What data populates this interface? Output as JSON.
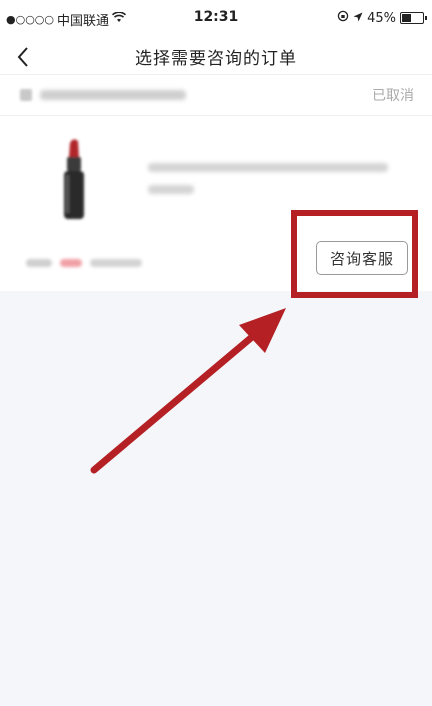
{
  "status_bar": {
    "carrier": "中国联通",
    "time": "12:31",
    "battery_percent": "45%",
    "battery_level": 0.45,
    "signal_dots": "●○○○○"
  },
  "nav": {
    "title": "选择需要咨询的订单"
  },
  "order": {
    "status": "已取消"
  },
  "consult_button": {
    "label": "咨询客服"
  },
  "colors": {
    "highlight": "#b42024",
    "background": "#f4f6fa"
  }
}
